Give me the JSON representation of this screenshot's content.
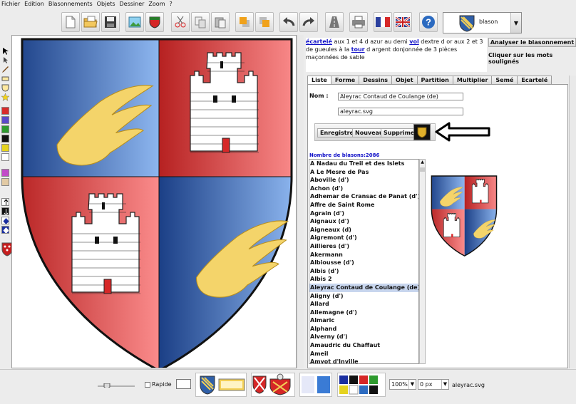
{
  "menu": [
    "Fichier",
    "Edition",
    "Blasonnements",
    "Objets",
    "Dessiner",
    "Zoom",
    "?"
  ],
  "toolbar": {
    "icons": [
      "new-document-icon",
      "open-folder-icon",
      "save-icon",
      "insert-image-icon",
      "shield-icon",
      "cut-icon",
      "copy-icon",
      "paste-icon",
      "bring-front-icon",
      "send-back-icon",
      "undo-icon",
      "redo-icon",
      "road-icon",
      "print-icon",
      "french-flag-icon",
      "english-flag-icon",
      "help-icon"
    ],
    "blason_combo": "blason"
  },
  "description": {
    "parts": [
      {
        "text": "écartelé",
        "link": true
      },
      {
        "text": " aux 1 et 4 d azur au demi ",
        "link": false
      },
      {
        "text": "vol",
        "link": true
      },
      {
        "text": " dextre d or aux 2 et 3 de gueules à la ",
        "link": false
      },
      {
        "text": "tour",
        "link": true
      },
      {
        "text": " d argent donjonnée de 3 pièces maçonnées de sable",
        "link": false
      }
    ]
  },
  "analyze_button": "Analyser le blasonnement",
  "hint": "Cliquer sur les mots soulignés",
  "tabs": [
    "Liste",
    "Forme",
    "Dessins",
    "Objet",
    "Partition",
    "Multiplier",
    "Semé",
    "Ecartelé"
  ],
  "active_tab": "Liste",
  "form": {
    "nom_label": "Nom :",
    "nom_value": "Aleyrac Contaud de Coulange (de)",
    "file_value": "aleyrac.svg",
    "buttons": [
      "Enregistrer",
      "Nouveau",
      "Supprimer"
    ]
  },
  "count_label": "Nombre de blasons:2086",
  "list": [
    "A  Nadau du Treil et des Islets",
    "A Le Mesre de Pas",
    "Aboville (d')",
    "Achon (d')",
    "Adhemar de Cransac de Panat (d')",
    "Affre de Saint Rome",
    "Agrain (d')",
    "Aignaux (d')",
    "Aigneaux (d)",
    "Aigremont (d')",
    "Aillieres (d')",
    "Akermann",
    "Albiousse (d')",
    "Albis (d')",
    "Albis 2",
    "Aleyrac Contaud de Coulange (de)",
    "Aligny (d')",
    "Allard",
    "Allemagne (d')",
    "Almaric",
    "Alphand",
    "Alverny (d')",
    "Amaudric du Chaffaut",
    "Ameil",
    "Amyot d'Inville"
  ],
  "selected_item": "Aleyrac Contaud de Coulange (de)",
  "bottom": {
    "rapide_label": "Rapide",
    "zoom_select": "100%",
    "px_select": "0 px",
    "filename": "aleyrac.svg"
  },
  "colors": {
    "azure": "#2f5fa8",
    "gules": "#d33a3a",
    "or": "#f2cf56",
    "link": "#1010c8"
  },
  "palette": [
    "#d72b2b",
    "#5b49c9",
    "#2e9a2e",
    "#111111",
    "#e5d31f",
    "#ffffff",
    "#c24ac8",
    "#e2caa4"
  ]
}
